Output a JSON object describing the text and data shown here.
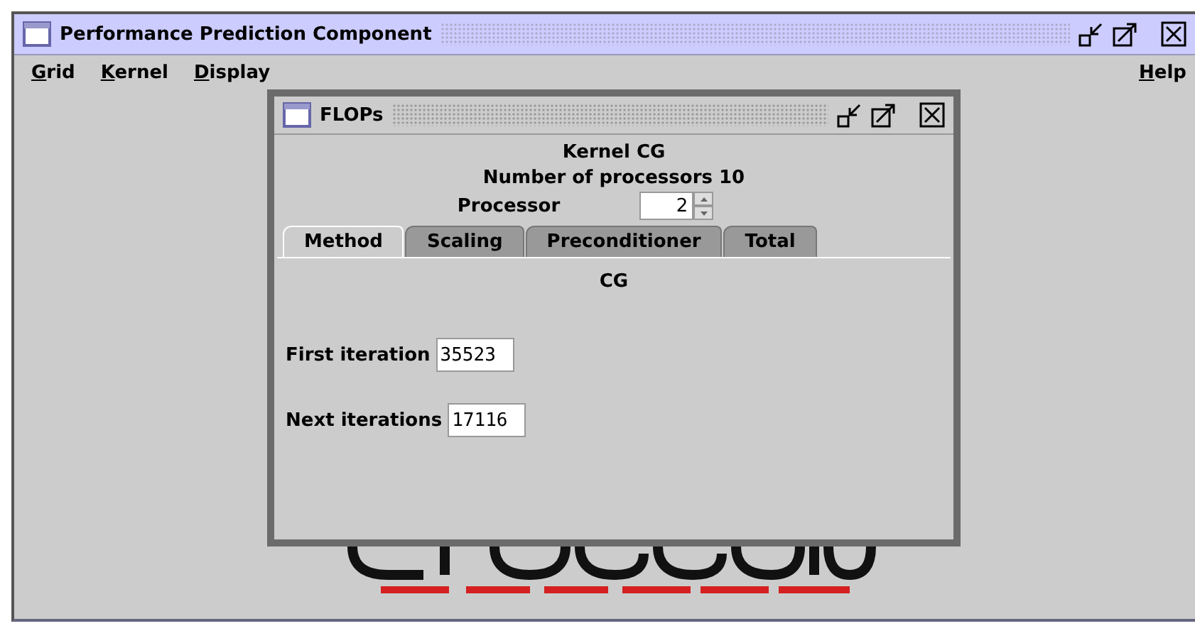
{
  "window": {
    "title": "Performance Prediction Component"
  },
  "menu": [
    {
      "label": "Grid"
    },
    {
      "label": "Kernel"
    },
    {
      "label": "Display"
    }
  ],
  "help_menu": {
    "label": "Help"
  },
  "dialog": {
    "title": "FLOPs",
    "kernel": "Kernel CG",
    "processors": "Number of processors 10",
    "processor_label": "Processor",
    "processor_value": "2",
    "tabs": [
      {
        "label": "Method",
        "selected": true
      },
      {
        "label": "Scaling",
        "selected": false
      },
      {
        "label": "Preconditioner",
        "selected": false
      },
      {
        "label": "Total",
        "selected": false
      }
    ],
    "method": "CG",
    "fields": [
      {
        "label": "First iteration",
        "value": "35523"
      },
      {
        "label": "Next iterations",
        "value": "17116"
      }
    ]
  }
}
